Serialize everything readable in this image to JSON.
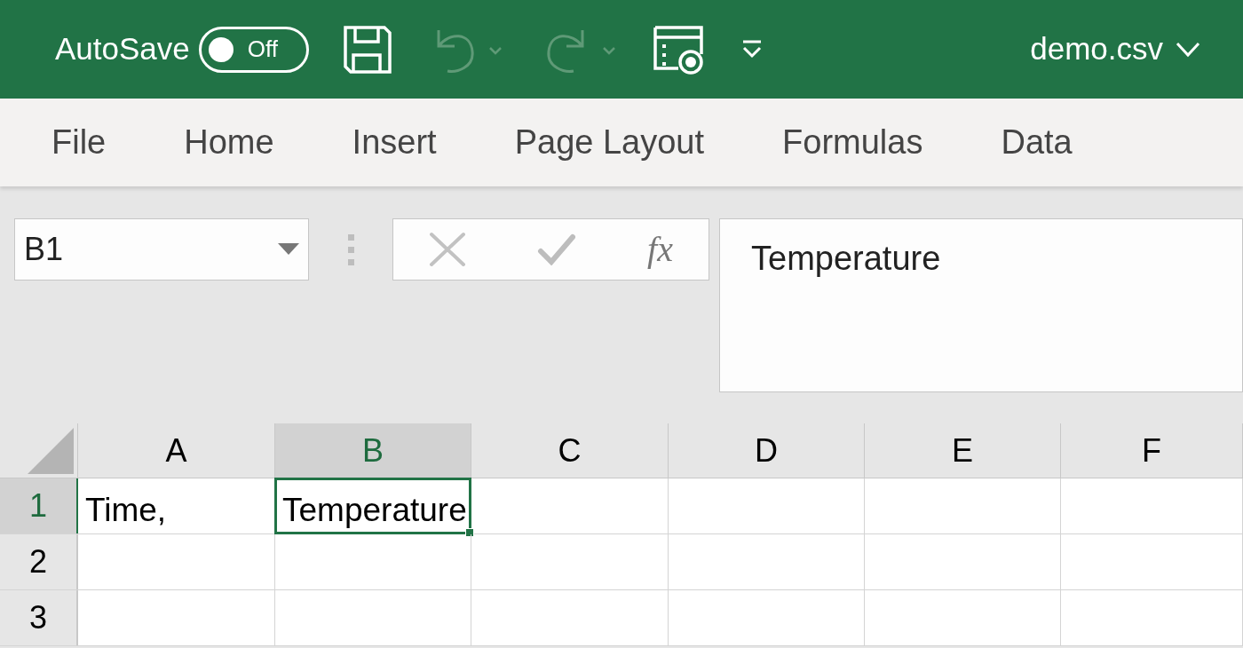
{
  "title_bar": {
    "autosave_label": "AutoSave",
    "autosave_toggle": {
      "label": "Off",
      "on": false
    },
    "quick_access": [
      {
        "kind": "save",
        "disabled": false
      },
      {
        "kind": "undo",
        "disabled": true
      },
      {
        "kind": "redo",
        "disabled": true
      },
      {
        "kind": "form",
        "disabled": false
      },
      {
        "kind": "customize",
        "disabled": false
      }
    ],
    "file_name": "demo.csv"
  },
  "ribbon_tabs": [
    {
      "label": "File",
      "selected": false
    },
    {
      "label": "Home",
      "selected": false
    },
    {
      "label": "Insert",
      "selected": false
    },
    {
      "label": "Page Layout",
      "selected": false
    },
    {
      "label": "Formulas",
      "selected": false
    },
    {
      "label": "Data",
      "selected": false
    }
  ],
  "name_box": {
    "value": "B1"
  },
  "formula_bar": {
    "function_label": "fx",
    "cancel_disabled": true,
    "enter_disabled": true,
    "value": "Temperature"
  },
  "grid": {
    "columns": [
      {
        "label": "A",
        "selected": false
      },
      {
        "label": "B",
        "selected": true
      },
      {
        "label": "C",
        "selected": false
      },
      {
        "label": "D",
        "selected": false
      },
      {
        "label": "E",
        "selected": false
      },
      {
        "label": "F",
        "selected": false
      }
    ],
    "rows": [
      {
        "label": "1",
        "selected": true,
        "cells": [
          {
            "text": "Time,",
            "selected": false
          },
          {
            "text": "Temperature",
            "selected": true
          }
        ]
      },
      {
        "label": "2",
        "selected": false
      },
      {
        "label": "3",
        "selected": false
      }
    ]
  }
}
